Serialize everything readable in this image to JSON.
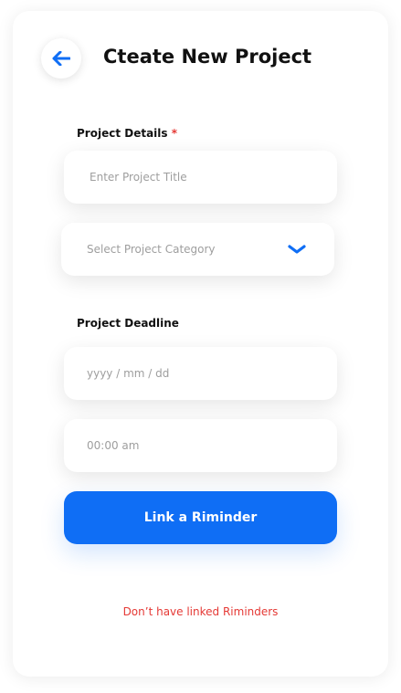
{
  "header": {
    "title": "Cteate New Project",
    "back_icon": "arrow-left-icon"
  },
  "details": {
    "label": "Project Details",
    "required_mark": "*",
    "title_placeholder": "Enter Project Title",
    "category_placeholder": "Select Project Category",
    "category_icon": "chevron-down-icon"
  },
  "deadline": {
    "label": "Project Deadline",
    "date_placeholder": "yyyy / mm / dd",
    "time_placeholder": "00:00 am"
  },
  "actions": {
    "primary_label": "Link a Riminder",
    "secondary_link": "Don’t have linked Riminders"
  },
  "colors": {
    "accent": "#0f6ef5",
    "required": "#e53935",
    "link": "#e53935"
  }
}
